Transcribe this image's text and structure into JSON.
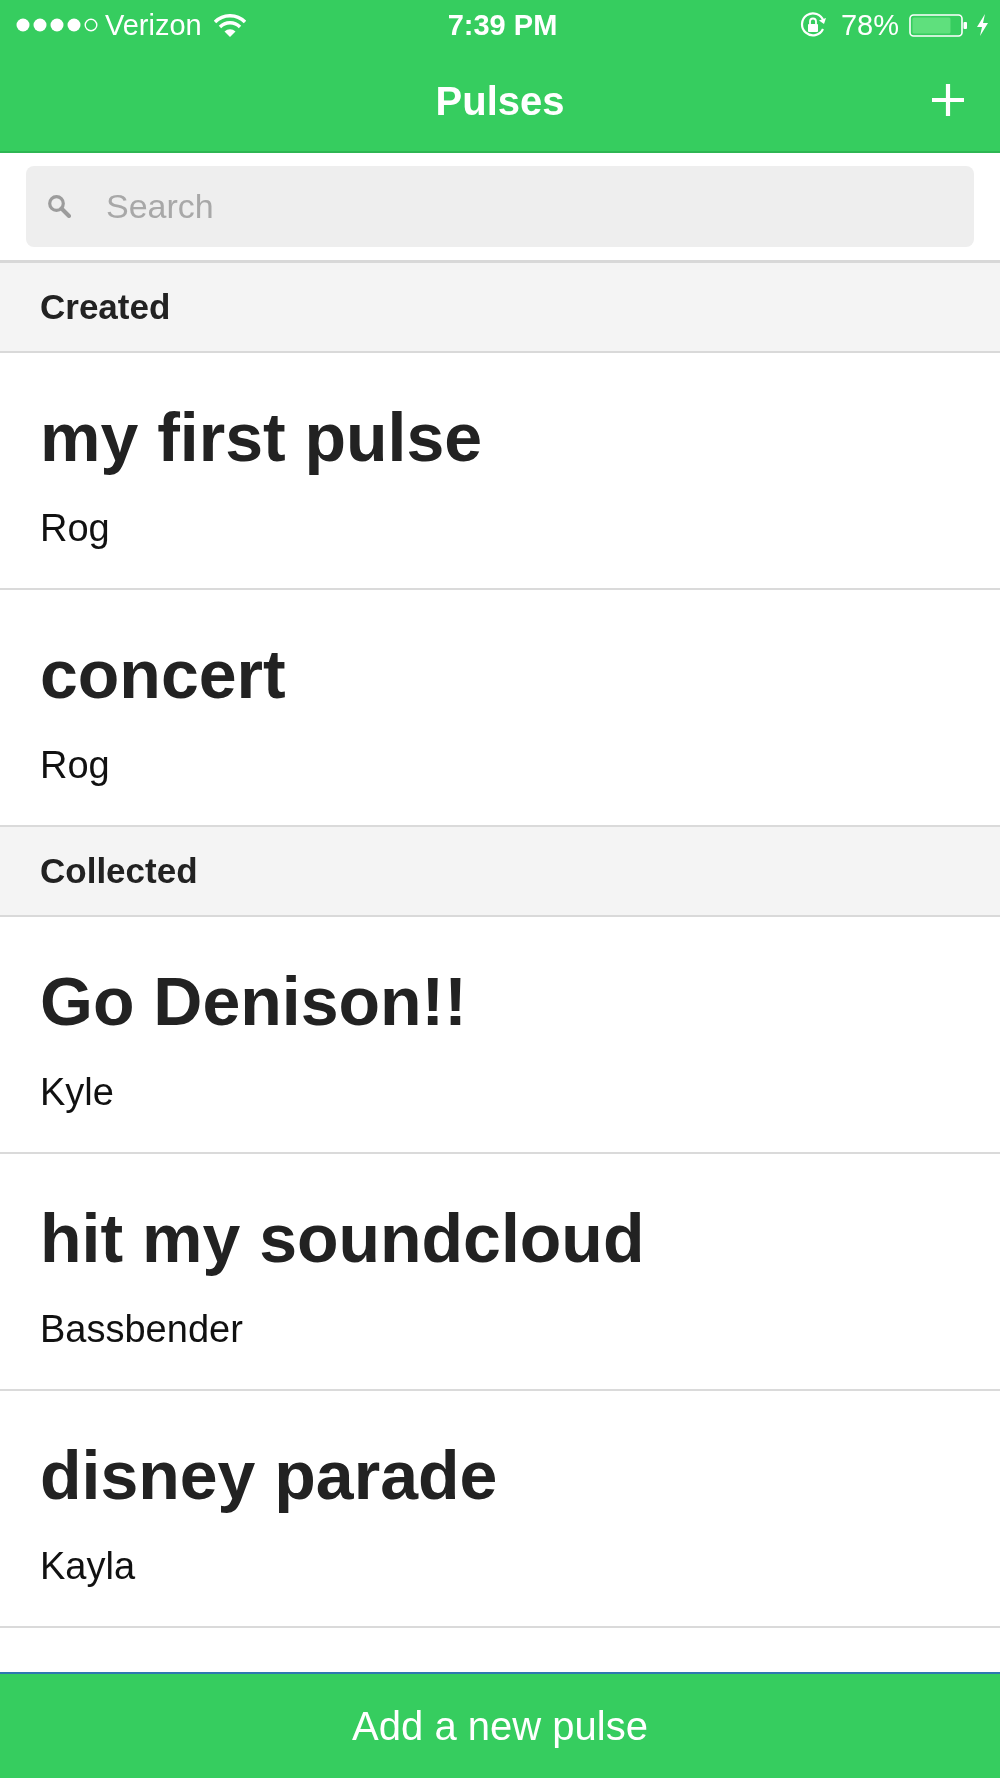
{
  "status_bar": {
    "carrier": "Verizon",
    "time": "7:39 PM",
    "battery": "78%"
  },
  "nav_bar": {
    "title": "Pulses"
  },
  "search": {
    "placeholder": "Search"
  },
  "sections": [
    {
      "title": "Created",
      "items": [
        {
          "title": "my first pulse",
          "author": "Rog"
        },
        {
          "title": "concert",
          "author": "Rog"
        }
      ]
    },
    {
      "title": "Collected",
      "items": [
        {
          "title": "Go Denison!!",
          "author": "Kyle"
        },
        {
          "title": "hit my soundcloud",
          "author": "Bassbender"
        },
        {
          "title": "disney parade",
          "author": "Kayla"
        }
      ]
    }
  ],
  "bottom_button": {
    "label": "Add a new pulse"
  }
}
